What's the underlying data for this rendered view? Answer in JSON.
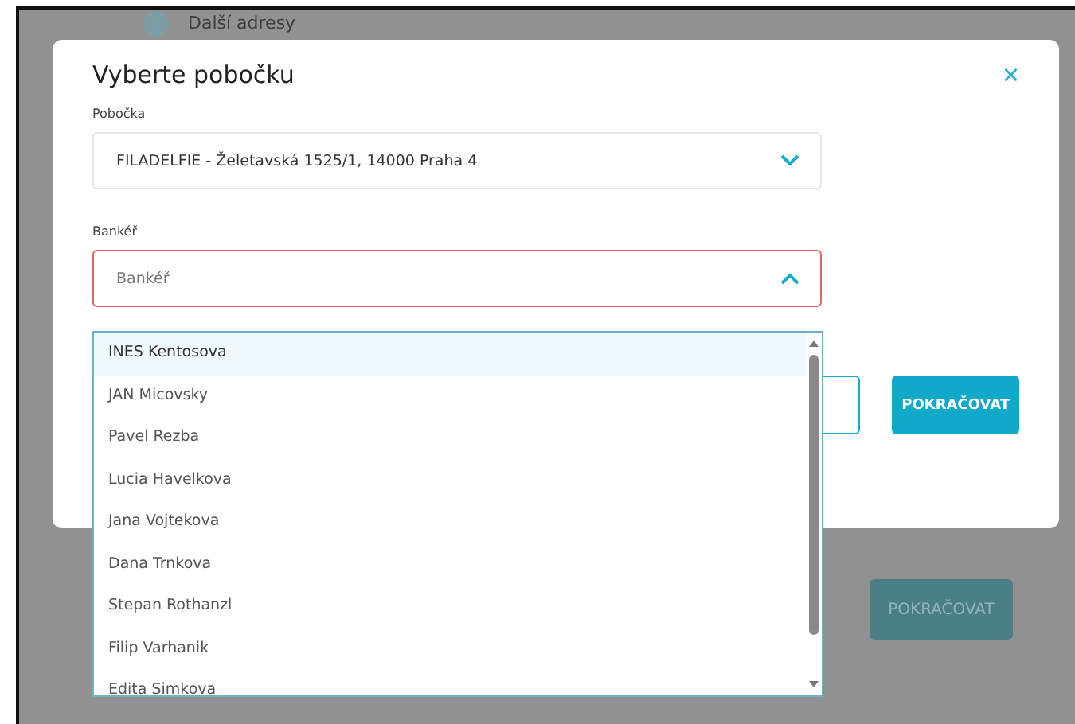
{
  "background": {
    "section_title": "Další adresy",
    "button": "POKRAČOVAT"
  },
  "dialog": {
    "title": "Vyberte pobočku",
    "close": "×",
    "branch": {
      "label": "Pobočka",
      "value": "FILADELFIE - Želetavská 1525/1, 14000 Praha 4",
      "expanded": false
    },
    "banker": {
      "label": "Bankéř",
      "placeholder": "Bankéř",
      "expanded": true,
      "invalid": true
    },
    "buttons": [
      {
        "kind": "secondary"
      },
      {
        "kind": "primary",
        "label": "POKRAČOVAT"
      }
    ]
  },
  "banker_options": [
    {
      "label": "INES Kentosova",
      "selected": true
    },
    {
      "label": "JAN Micovsky",
      "selected": false
    },
    {
      "label": "Pavel Rezba",
      "selected": false
    },
    {
      "label": "Lucia Havelkova",
      "selected": false
    },
    {
      "label": "Jana Vojtekova",
      "selected": false
    },
    {
      "label": "Dana Trnkova",
      "selected": false
    },
    {
      "label": "Stepan Rothanzl",
      "selected": false
    },
    {
      "label": "Filip Varhanik",
      "selected": false
    },
    {
      "label": "Edita Simkova",
      "selected": false
    }
  ]
}
